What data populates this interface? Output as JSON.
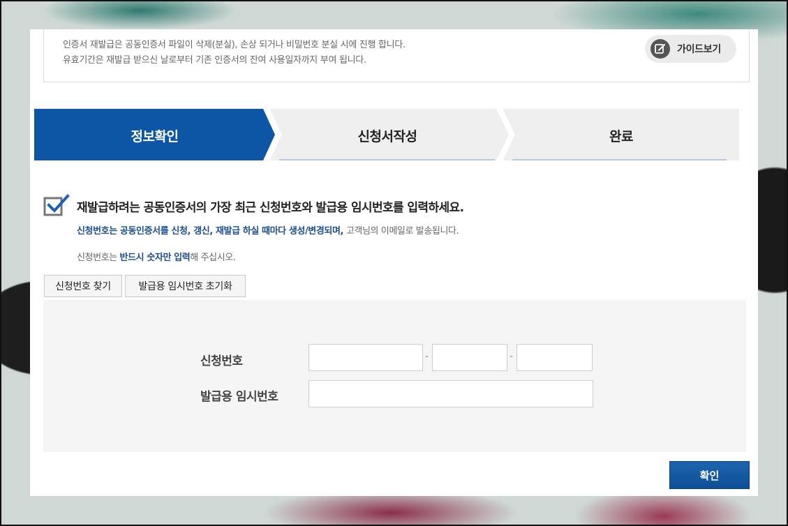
{
  "info": {
    "line1": "인증서 재발급은 공동인증서 파일이 삭제(분실), 손상 되거나 비밀번호 분실 시에 진행 합니다.",
    "line2": "유효기간은 재발급 받으신 날로부터 기존 인증서의 잔여 사용일자까지 부여 됩니다.",
    "guide_button": "가이드보기",
    "guide_icon": "edit-note-icon"
  },
  "steps": [
    {
      "label": "정보확인",
      "active": true
    },
    {
      "label": "신청서작성",
      "active": false
    },
    {
      "label": "완료",
      "active": false
    }
  ],
  "colors": {
    "active_step": "#0d56a6",
    "inactive_step": "#efefef",
    "accent_text": "#1a4e8f",
    "confirm_button": "#0d56a6"
  },
  "instructions": {
    "title": "재발급하려는 공동인증서의 가장 최근 신청번호와 발급용 임시번호를 입력하세요.",
    "note1_highlight": "신청번호는 공동인증서를 신청, 갱신, 재발급 하실 때마다 생성/변경되며,",
    "note1_rest": " 고객님의 이메일로 발송됩니다.",
    "note2_pre": "신청번호는 ",
    "note2_highlight": "반드시 숫자만 입력",
    "note2_post": "해 주십시오."
  },
  "buttons": {
    "find_number": "신청번호 찾기",
    "reset_temp": "발급용 임시번호 초기화",
    "confirm": "확인"
  },
  "form": {
    "app_number_label": "신청번호",
    "app_number_part1": "",
    "app_number_part2": "",
    "app_number_part3": "",
    "separator": "-",
    "temp_number_label": "발급용 임시번호",
    "temp_number": ""
  }
}
